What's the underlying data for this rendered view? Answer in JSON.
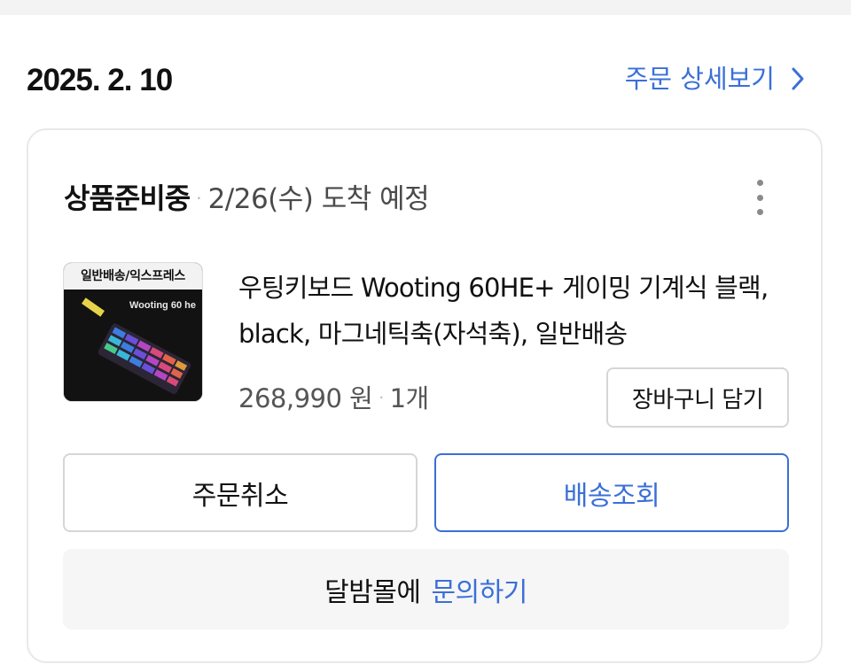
{
  "order": {
    "date": "2025. 2. 10",
    "detail_link_label": "주문 상세보기",
    "detail_link_icon": "chevron-right-icon"
  },
  "shipment": {
    "status": "상품준비중",
    "eta": "2/26(수) 도착 예정",
    "more_icon": "more-vertical-icon"
  },
  "product": {
    "thumbnail_banner": "일반배송/익스프레스",
    "thumbnail_caption": "Wooting 60 he",
    "name": "우팅키보드 Wooting 60HE+ 게이밍 기계식 블랙, black, 마그네틱축(자석축), 일반배송",
    "price": "268,990 원",
    "quantity": "1개",
    "cart_button_label": "장바구니 담기"
  },
  "actions": {
    "cancel_label": "주문취소",
    "track_label": "배송조회"
  },
  "inquiry": {
    "seller_text": "달밤몰에",
    "ask_label": "문의하기"
  },
  "colors": {
    "accent": "#3a6fd8",
    "border": "#d6d6d6",
    "card_border": "#e8e8e8",
    "page_bg": "#f3f3f3"
  }
}
